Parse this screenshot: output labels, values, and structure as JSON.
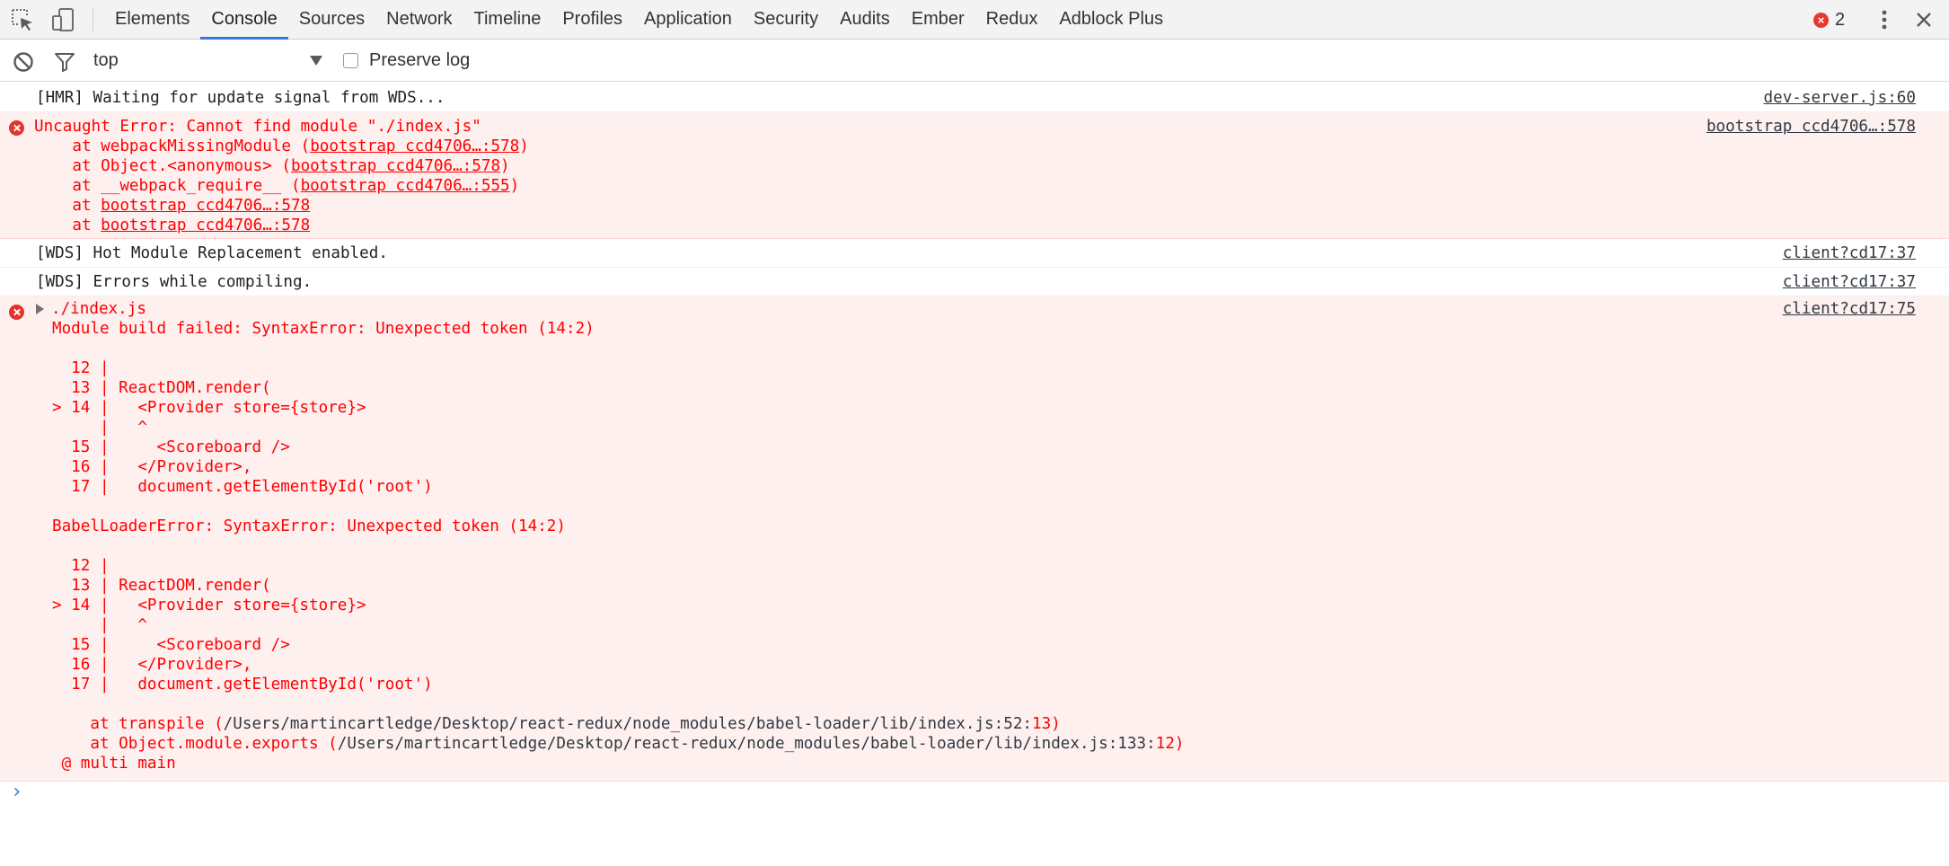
{
  "toolbar": {
    "tabs": [
      "Elements",
      "Console",
      "Sources",
      "Network",
      "Timeline",
      "Profiles",
      "Application",
      "Security",
      "Audits",
      "Ember",
      "Redux",
      "Adblock Plus"
    ],
    "active_tab": "Console",
    "error_count": "2",
    "accent_color": "#3879d9",
    "error_color": "#e73a2f"
  },
  "filter": {
    "context": "top",
    "preserve_log_label": "Preserve log",
    "preserve_log_checked": false
  },
  "messages": {
    "hmr": {
      "text": "[HMR] Waiting for update signal from WDS...",
      "source": "dev-server.js:60"
    },
    "uncaught": {
      "title": "Uncaught Error: Cannot find module \"./index.js\"",
      "source": "bootstrap ccd4706…:578",
      "stack": [
        {
          "prefix": "    at webpackMissingModule (",
          "link": "bootstrap ccd4706…:578",
          "suffix": ")"
        },
        {
          "prefix": "    at Object.<anonymous> (",
          "link": "bootstrap ccd4706…:578",
          "suffix": ")"
        },
        {
          "prefix": "    at __webpack_require__ (",
          "link": "bootstrap ccd4706…:555",
          "suffix": ")"
        },
        {
          "prefix": "    at ",
          "link": "bootstrap ccd4706…:578",
          "suffix": ""
        },
        {
          "prefix": "    at ",
          "link": "bootstrap ccd4706…:578",
          "suffix": ""
        }
      ]
    },
    "wds_hmr": {
      "text": "[WDS] Hot Module Replacement enabled.",
      "source": "client?cd17:37"
    },
    "wds_err": {
      "text": "[WDS] Errors while compiling.",
      "source": "client?cd17:37"
    },
    "build": {
      "file": "./index.js",
      "source": "client?cd17:75",
      "lines": [
        "Module build failed: SyntaxError: Unexpected token (14:2)",
        "",
        "  12 |",
        "  13 | ReactDOM.render(",
        "> 14 |   <Provider store={store}>",
        "     |   ^",
        "  15 |     <Scoreboard />",
        "  16 |   </Provider>,",
        "  17 |   document.getElementById('root')",
        "",
        "BabelLoaderError: SyntaxError: Unexpected token (14:2)",
        "",
        "  12 |",
        "  13 | ReactDOM.render(",
        "> 14 |   <Provider store={store}>",
        "     |   ^",
        "  15 |     <Scoreboard />",
        "  16 |   </Provider>,",
        "  17 |   document.getElementById('root')",
        ""
      ],
      "trace": [
        {
          "prefix": "    at transpile (",
          "path": "/Users/martincartledge/Desktop/react-redux/node_modules/babel-loader/lib/index.js:52:",
          "col": "13",
          "suffix": ")"
        },
        {
          "prefix": "    at Object.module.exports (",
          "path": "/Users/martincartledge/Desktop/react-redux/node_modules/babel-loader/lib/index.js:133:",
          "col": "12",
          "suffix": ")"
        }
      ],
      "tail": " @ multi main"
    }
  },
  "prompt_symbol": "›"
}
